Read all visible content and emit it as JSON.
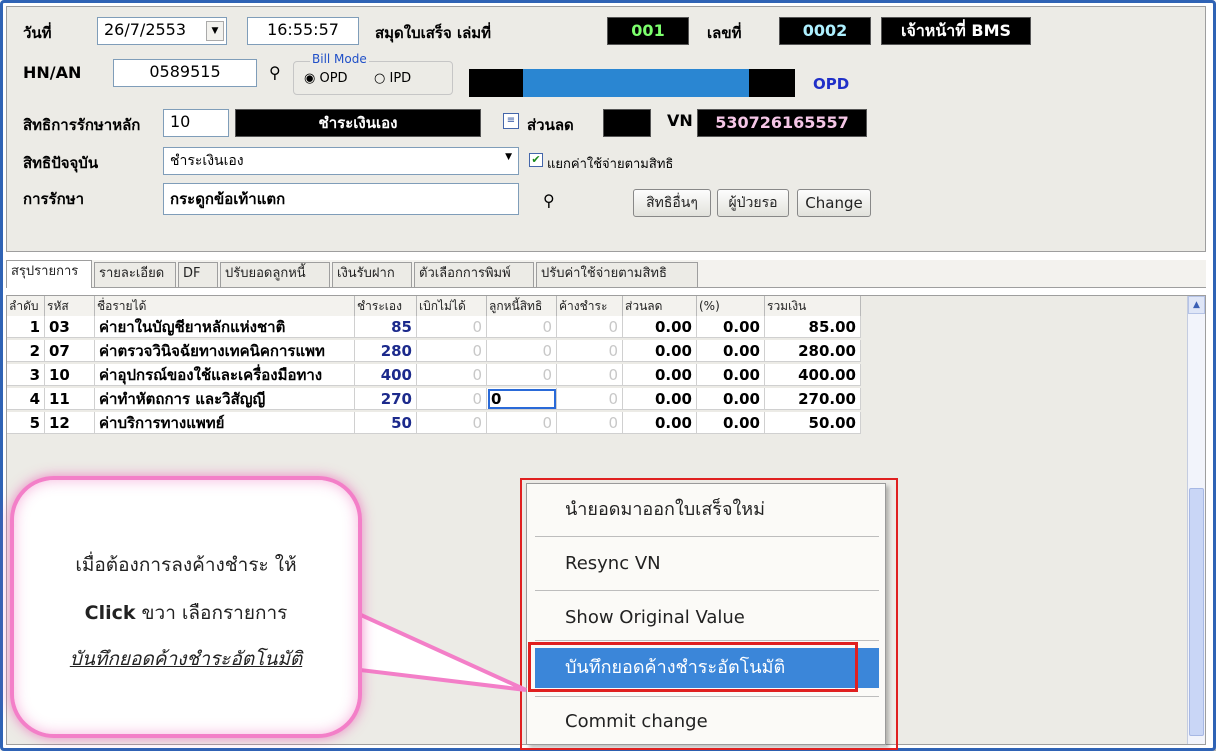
{
  "header": {
    "date_label": "วันที่",
    "date_value": "26/7/2553",
    "time_value": "16:55:57",
    "receipt_book_label": "สมุดใบเสร็จ  เล่มที่",
    "receipt_book_value": "001",
    "number_label": "เลขที่",
    "number_value": "0002",
    "officer_label": "เจ้าหน้าที่ BMS",
    "hn_label": "HN/AN",
    "hn_value": "0589515",
    "bill_mode_label": "Bill Mode",
    "bill_mode_opd": "OPD",
    "bill_mode_ipd": "IPD",
    "opd_label": "OPD",
    "main_right_label": "สิทธิการรักษาหลัก",
    "main_right_code": "10",
    "main_right_name": "ชำระเงินเอง",
    "discount_label": "ส่วนลด",
    "vn_label": "VN",
    "vn_value": "530726165557",
    "current_right_label": "สิทธิปัจจุบัน",
    "current_right_value": "ชำระเงินเอง",
    "split_label": "แยกค่าใช้จ่ายตามสิทธิ",
    "treatment_label": "การรักษา",
    "treatment_value": "กระดูกข้อเท้าแตก",
    "btn_other_rights": "สิทธิอื่นๆ",
    "btn_waiting": "ผู้ป่วยรอ",
    "btn_change": "Change"
  },
  "tabs": [
    {
      "label": "สรุปรายการ"
    },
    {
      "label": "รายละเอียด"
    },
    {
      "label": "DF"
    },
    {
      "label": "ปรับยอดลูกหนี้"
    },
    {
      "label": "เงินรับฝาก"
    },
    {
      "label": "ตัวเลือกการพิมพ์"
    },
    {
      "label": "ปรับค่าใช้จ่ายตามสิทธิ"
    }
  ],
  "grid": {
    "columns": [
      "ลำดับ",
      "รหัส",
      "ชื่อรายได้",
      "ชำระเอง",
      "เบิกไม่ได้",
      "ลูกหนี้สิทธิ",
      "ค้างชำระ",
      "ส่วนลด",
      "(%)",
      "รวมเงิน"
    ],
    "rows": [
      {
        "no": "1",
        "code": "03",
        "name": "ค่ายาในบัญชียาหลักแห่งชาติ",
        "self_pay": "85",
        "non_claim": "0",
        "debtor": "0",
        "outstanding": "0",
        "discount": "0.00",
        "percent": "0.00",
        "total": "85.00"
      },
      {
        "no": "2",
        "code": "07",
        "name": "ค่าตรวจวินิจฉัยทางเทคนิคการแพท",
        "self_pay": "280",
        "non_claim": "0",
        "debtor": "0",
        "outstanding": "0",
        "discount": "0.00",
        "percent": "0.00",
        "total": "280.00"
      },
      {
        "no": "3",
        "code": "10",
        "name": "ค่าอุปกรณ์ของใช้และเครื่องมือทาง",
        "self_pay": "400",
        "non_claim": "0",
        "debtor": "0",
        "outstanding": "0",
        "discount": "0.00",
        "percent": "0.00",
        "total": "400.00"
      },
      {
        "no": "4",
        "code": "11",
        "name": "ค่าทำหัตถการ และวิสัญญี",
        "self_pay": "270",
        "non_claim": "0",
        "debtor": "0",
        "outstanding": "0",
        "discount": "0.00",
        "percent": "0.00",
        "total": "270.00"
      },
      {
        "no": "5",
        "code": "12",
        "name": "ค่าบริการทางแพทย์",
        "self_pay": "50",
        "non_claim": "0",
        "debtor": "0",
        "outstanding": "0",
        "discount": "0.00",
        "percent": "0.00",
        "total": "50.00"
      }
    ]
  },
  "context_menu": {
    "items": [
      {
        "label": "นำยอดมาออกใบเสร็จใหม่"
      },
      {
        "label": "Resync VN"
      },
      {
        "label": "Show Original Value"
      },
      {
        "label": "บันทึกยอดค้างชำระอัตโนมัติ"
      },
      {
        "label": "Commit change"
      }
    ]
  },
  "callout": {
    "line1": "เมื่อต้องการลงค้างชำระ ให้",
    "line2_bold": "Click",
    "line2_rest": " ขวา เลือกรายการ",
    "line3": "บันทึกยอดค้างชำระอัตโนมัติ"
  },
  "colors": {
    "frame_blue": "#2f63b5",
    "selection_blue": "#3b86d9",
    "highlight_red": "#e02020",
    "callout_pink": "#f37fc8",
    "value_blue": "#1c2a8c"
  }
}
